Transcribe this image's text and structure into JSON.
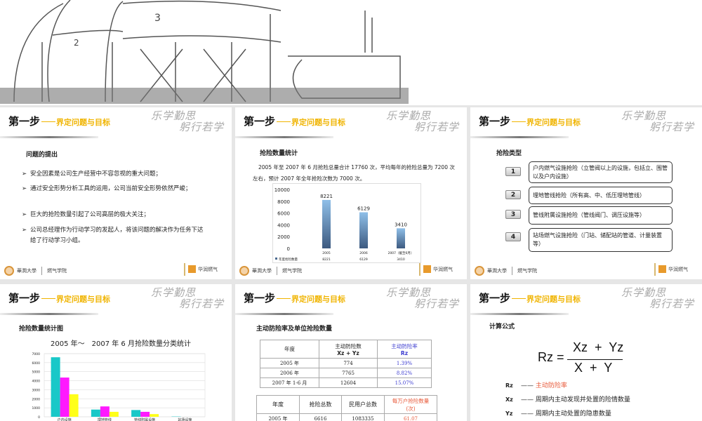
{
  "common": {
    "step_title": "第一步",
    "step_subtitle": "界定问题与目标",
    "motto_logo": "乐学勤思 躬行若学",
    "footer_left_brand": "華潤大學",
    "footer_left_college": "燃气学院",
    "footer_right_brand": "华润燃气"
  },
  "slide1": {
    "heading": "问题的提出",
    "bullets": [
      "安全因素是公司生产经营中不容忽视的重大问题；",
      "通过安全形势分析工具的运用，公司当前安全形势依然严峻；",
      "巨大的抢险数量引起了公司高层的极大关注；",
      "公司总经理作为行动学习的发起人，将该问题的解决作为任务下达给了行动学习小组。"
    ]
  },
  "slide2": {
    "heading": "抢险数量统计",
    "paragraph": "2005 年至 2007 年 6 月抢险总量合计 17760 次，平均每年的抢险总量为 7200 次左右，预计 2007 年全年抢险次数为 7000 次。",
    "chart_data": {
      "type": "bar",
      "categories": [
        "2005",
        "2006",
        "2007（截至6月）"
      ],
      "series": [
        {
          "name": "年度抢险数量",
          "values": [
            8221,
            6129,
            3410
          ]
        }
      ],
      "yticks": [
        "0",
        "2000",
        "4000",
        "6000",
        "8000",
        "10000"
      ],
      "ylim": [
        0,
        10000
      ],
      "data_labels": [
        "8221",
        "6129",
        "3410"
      ],
      "legend_label": "年度抢险数量",
      "bar_color": "#8fbfe8"
    }
  },
  "slide3": {
    "heading": "抢险类型",
    "items": [
      {
        "num": "1",
        "text": "户内燃气设施抢险（立管阀以上的设施，包括立、围管以及户内设施）"
      },
      {
        "num": "2",
        "text": "埋地管线抢险（所有高、中、低压埋地管线）"
      },
      {
        "num": "3",
        "text": "管线附属设施抢险（管线阀门、调压设施等）"
      },
      {
        "num": "4",
        "text": "站场燃气设施抢险（门站、储配站的管道、计量装置等）"
      }
    ]
  },
  "slide4": {
    "heading": "抢险数量统计图",
    "chart_data": {
      "type": "bar",
      "title": "2005 年～　2007 年 6 月抢险数量分类统计",
      "categories": [
        "户内设施",
        "埋地管线",
        "管线附属设施",
        "站场设施"
      ],
      "series": [
        {
          "color": "#19c8c8",
          "values": [
            6600,
            800,
            750,
            30
          ]
        },
        {
          "color": "#ff19ff",
          "values": [
            4350,
            1150,
            550,
            0
          ]
        },
        {
          "color": "#ffff19",
          "values": [
            2500,
            550,
            300,
            0
          ]
        }
      ],
      "yticks": [
        "0",
        "1000",
        "2000",
        "3000",
        "4000",
        "5000",
        "6000",
        "7000"
      ],
      "ylim": [
        0,
        7000
      ],
      "grid": true
    }
  },
  "slide5": {
    "heading": "主动防险率及单位抢险数量",
    "table1": {
      "headers": [
        "年度",
        "主动防险数",
        "Xz + Yz",
        "主动防险率",
        "Rz"
      ],
      "rows": [
        [
          "2005 年",
          "774",
          "1.39%"
        ],
        [
          "2006 年",
          "7765",
          "8.82%"
        ],
        [
          "2007 年 1-6 月",
          "12604",
          "15.07%"
        ]
      ]
    },
    "table2": {
      "headers": [
        "年度",
        "抢险总数",
        "民用户总数",
        "每万户抢险数量",
        "(次)"
      ],
      "rows": [
        [
          "2005 年",
          "6616",
          "1083335",
          "61.07"
        ]
      ]
    }
  },
  "slide6": {
    "heading": "计算公式",
    "formula": {
      "lhs": "Rz =",
      "numerator": "Xz  +  Yz",
      "denominator": "X  +  Y"
    },
    "definitions": [
      {
        "sym": "Rz",
        "dash": "——",
        "text": "主动防险率"
      },
      {
        "sym": "Xz",
        "dash": "——",
        "text": "周期内主动发现并处置的险情数量"
      },
      {
        "sym": "Yz",
        "dash": "——",
        "text": "周期内主动处置的隐患数量"
      }
    ]
  }
}
